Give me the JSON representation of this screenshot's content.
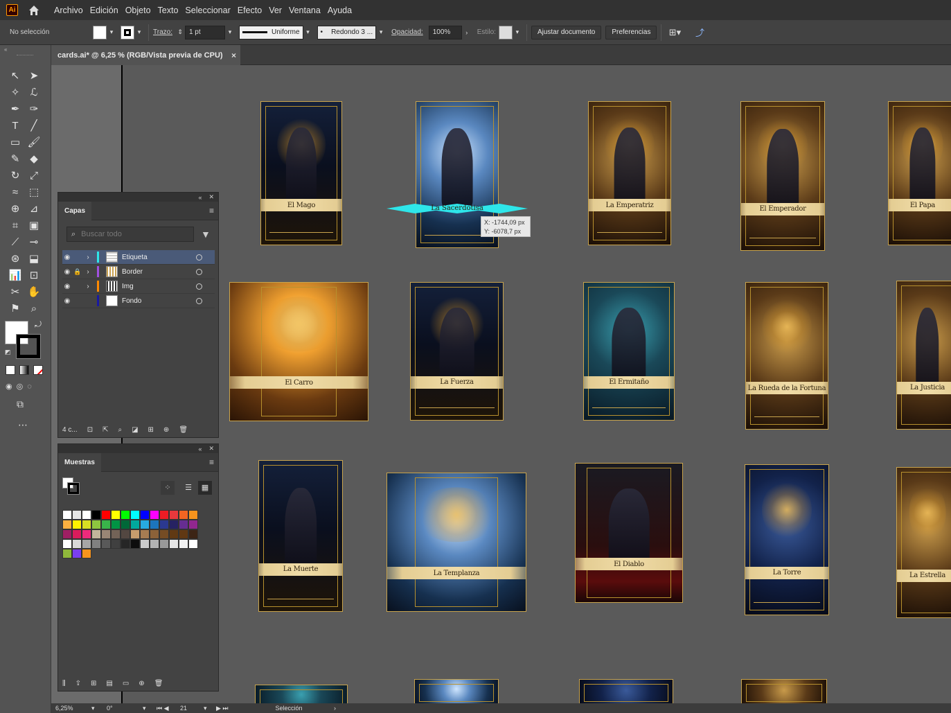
{
  "app": {
    "logo": "Ai",
    "menu": [
      "Archivo",
      "Edición",
      "Objeto",
      "Texto",
      "Seleccionar",
      "Efecto",
      "Ver",
      "Ventana",
      "Ayuda"
    ]
  },
  "control_bar": {
    "selection_status": "No selección",
    "stroke_label": "Trazo:",
    "stroke_weight": "1 pt",
    "stroke_profile": "Uniforme",
    "brush": "Redondo 3 ...",
    "opacity_label": "Opacidad:",
    "opacity_value": "100%",
    "style_label": "Estilo:",
    "adjust_button": "Ajustar documento",
    "prefs_button": "Preferencias"
  },
  "document": {
    "tab_title": "cards.ai* @ 6,25 % (RGB/Vista previa de CPU)",
    "tab_close": "×"
  },
  "canvas": {
    "tooltip_x": "X: -1744,09 px",
    "tooltip_y": "Y: -6078,7 px",
    "selected_label": "La Sacerdotisa",
    "cards": [
      {
        "label": "El Mago",
        "style": "night"
      },
      {
        "label": "La Sacerdotisa",
        "style": "blue"
      },
      {
        "label": "La Emperatriz",
        "style": "gold"
      },
      {
        "label": "El Emperador",
        "style": "gold"
      },
      {
        "label": "El Papa",
        "style": "gold"
      },
      {
        "label": "El Carro",
        "style": "sun"
      },
      {
        "label": "La Fuerza",
        "style": "night"
      },
      {
        "label": "El Ermitaño",
        "style": "teal"
      },
      {
        "label": "La Rueda de la Fortuna",
        "style": "gold"
      },
      {
        "label": "La Justicia",
        "style": "gold"
      },
      {
        "label": "La Muerte",
        "style": "night"
      },
      {
        "label": "La Templanza",
        "style": "blue"
      },
      {
        "label": "El Diablo",
        "style": "red"
      },
      {
        "label": "La Torre",
        "style": "night"
      },
      {
        "label": "La Estrella",
        "style": "gold"
      }
    ]
  },
  "layers_panel": {
    "tab": "Capas",
    "search_placeholder": "Buscar todo",
    "layers": [
      {
        "name": "Etiqueta",
        "color": "#2ee6ea",
        "locked": false,
        "active": true
      },
      {
        "name": "Border",
        "color": "#a050e0",
        "locked": true,
        "active": false
      },
      {
        "name": "Img",
        "color": "#ff8a00",
        "locked": false,
        "active": false
      },
      {
        "name": "Fondo",
        "color": "#1a1aa0",
        "locked": false,
        "active": false
      }
    ],
    "footer_count": "4 c..."
  },
  "swatches_panel": {
    "tab": "Muestras",
    "colors": [
      "#ffffff",
      "#e6e6e6",
      "#ffffff",
      "#000000",
      "#ff0000",
      "#ffff00",
      "#00ff00",
      "#00ffff",
      "#0000ff",
      "#ff00ff",
      "#ed1c24",
      "#e8393c",
      "#f26522",
      "#f7941d",
      "#fbb040",
      "#fff200",
      "#d7df23",
      "#8dc63f",
      "#39b54a",
      "#009444",
      "#006838",
      "#00a99d",
      "#27aae1",
      "#1c75bc",
      "#2b3990",
      "#262262",
      "#662d91",
      "#92278f",
      "#9e1f63",
      "#da1c5c",
      "#ee2a7b",
      "#c2b59b",
      "#998675",
      "#736357",
      "#534741",
      "#c69c6d",
      "#a67c52",
      "#8c6239",
      "#754c24",
      "#603913",
      "#603813",
      "#3c2415",
      "#ffffff",
      "#d9d9d9",
      "#a6a6a6",
      "#808080",
      "#595959",
      "#404040",
      "#262626",
      "#0d0d0d",
      "#cccccc",
      "#b3b3b3",
      "#999999",
      "#e6e6e6",
      "#f2f2f2",
      "#ffffff",
      "#8fb93b",
      "#7a3ff0",
      "#f7941d"
    ]
  },
  "status_bar": {
    "zoom": "6,25%",
    "angle": "0°",
    "artboard": "21",
    "tool": "Selección"
  }
}
